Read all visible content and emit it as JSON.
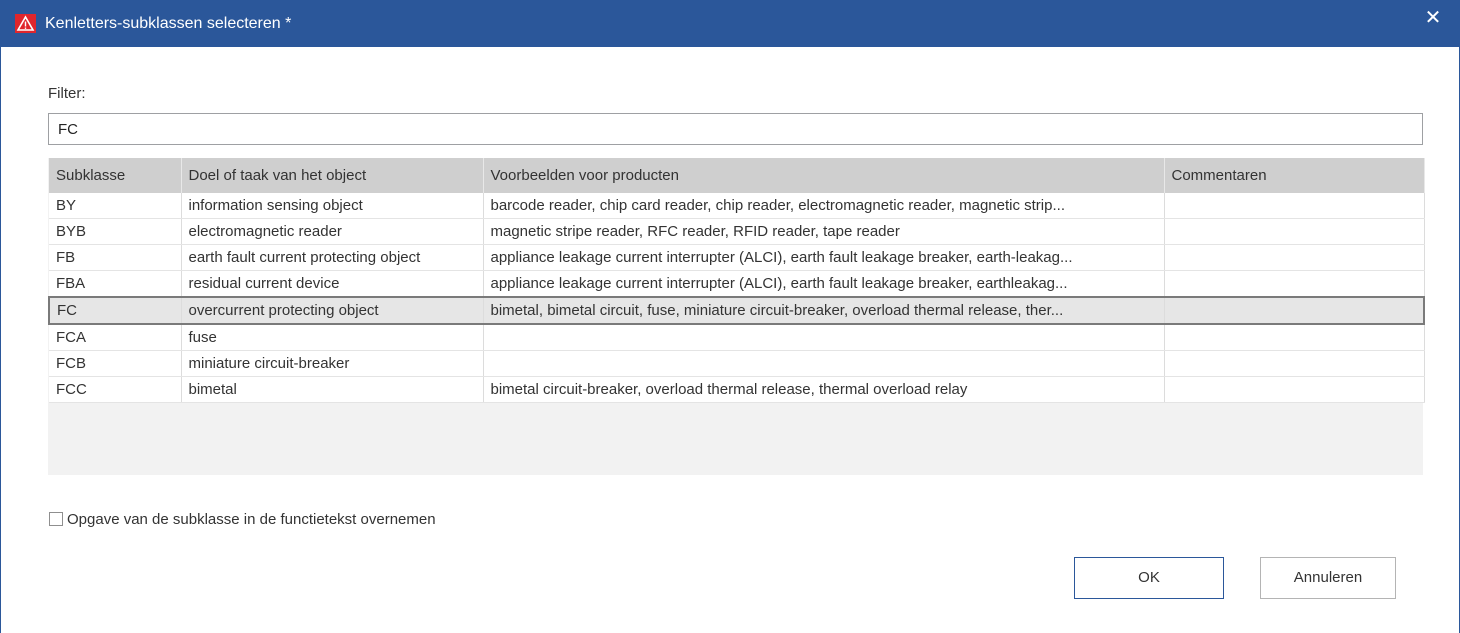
{
  "window": {
    "title": "Kenletters-subklassen selecteren *",
    "close_label": "✕",
    "accent_color": "#2b579a"
  },
  "filter": {
    "label": "Filter:",
    "value": "FC"
  },
  "table": {
    "columns": [
      "Subklasse",
      "Doel of taak van het object",
      "Voorbeelden voor producten",
      "Commentaren"
    ],
    "rows": [
      {
        "subklasse": "BY",
        "doel": "information sensing object",
        "voorbeelden": "barcode reader, chip card reader, chip reader, electromagnetic reader, magnetic strip...",
        "commentaren": ""
      },
      {
        "subklasse": "BYB",
        "doel": "electromagnetic reader",
        "voorbeelden": "magnetic stripe reader, RFC reader, RFID reader, tape reader",
        "commentaren": ""
      },
      {
        "subklasse": "FB",
        "doel": "earth fault current protecting object",
        "voorbeelden": "appliance leakage current interrupter (ALCI), earth fault leakage breaker, earth-leakag...",
        "commentaren": ""
      },
      {
        "subklasse": "FBA",
        "doel": "residual current device",
        "voorbeelden": "appliance leakage current interrupter (ALCI), earth fault leakage breaker, earthleakag...",
        "commentaren": ""
      },
      {
        "subklasse": "FC",
        "doel": "overcurrent protecting object",
        "voorbeelden": "bimetal, bimetal circuit, fuse, miniature circuit-breaker, overload thermal release, ther...",
        "commentaren": "",
        "selected": true
      },
      {
        "subklasse": "FCA",
        "doel": "fuse",
        "voorbeelden": "",
        "commentaren": ""
      },
      {
        "subklasse": "FCB",
        "doel": "miniature circuit-breaker",
        "voorbeelden": "",
        "commentaren": ""
      },
      {
        "subklasse": "FCC",
        "doel": "bimetal",
        "voorbeelden": "bimetal circuit-breaker, overload thermal release, thermal overload relay",
        "commentaren": ""
      }
    ]
  },
  "option": {
    "label": "Opgave van de subklasse in de functietekst overnemen",
    "checked": false
  },
  "buttons": {
    "ok": "OK",
    "cancel": "Annuleren"
  }
}
